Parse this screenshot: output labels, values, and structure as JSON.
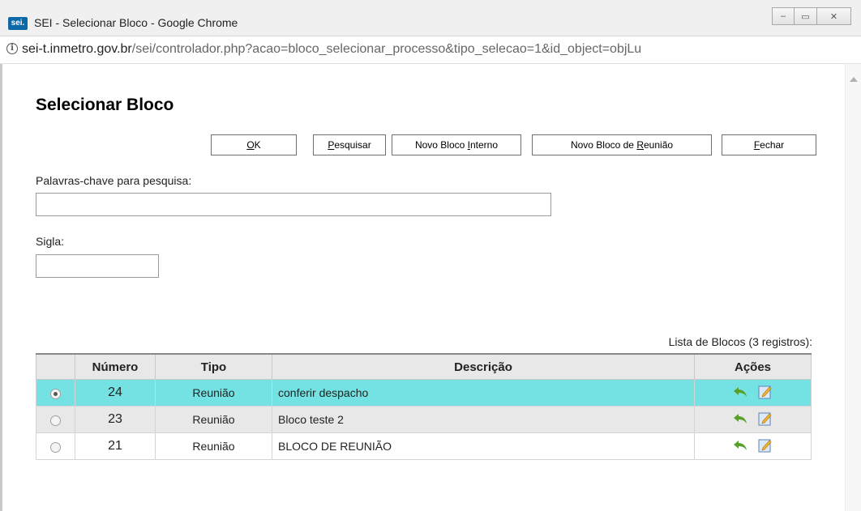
{
  "window": {
    "logo": "sei.",
    "title": "SEI - Selecionar Bloco - Google Chrome",
    "minimize_glyph": "–",
    "maximize_glyph": "▭",
    "close_glyph": "✕"
  },
  "address": {
    "host": "sei-t.inmetro.gov.br",
    "path": "/sei/controlador.php?acao=bloco_selecionar_processo&tipo_selecao=1&id_object=objLu"
  },
  "page": {
    "title": "Selecionar Bloco"
  },
  "toolbar": {
    "ok": {
      "pre": "",
      "key": "O",
      "post": "K"
    },
    "pesquisar": {
      "pre": "",
      "key": "P",
      "post": "esquisar"
    },
    "novo_interno": {
      "pre": "Novo Bloco ",
      "key": "I",
      "post": "nterno"
    },
    "novo_reuniao": {
      "pre": "Novo Bloco de ",
      "key": "R",
      "post": "eunião"
    },
    "fechar": {
      "pre": "",
      "key": "F",
      "post": "echar"
    }
  },
  "form": {
    "keywords_label": "Palavras-chave para pesquisa:",
    "keywords_value": "",
    "sigla_label": "Sigla:",
    "sigla_value": ""
  },
  "table": {
    "caption": "Lista de Blocos (3 registros):",
    "headers": {
      "radio": "",
      "numero": "Número",
      "tipo": "Tipo",
      "descricao": "Descrição",
      "acoes": "Ações"
    },
    "rows": [
      {
        "numero": "24",
        "tipo": "Reunião",
        "descricao": "conferir despacho"
      },
      {
        "numero": "23",
        "tipo": "Reunião",
        "descricao": "Bloco teste 2"
      },
      {
        "numero": "21",
        "tipo": "Reunião",
        "descricao": "BLOCO DE REUNIÃO"
      }
    ],
    "selected_row": 0,
    "action_icons": [
      "select-arrow-icon",
      "edit-pencil-icon"
    ]
  },
  "colors": {
    "selected_row": "#74e2e2",
    "alt_row": "#e8e8e8",
    "number_text": "#1a8f1a",
    "arrow_icon": "#5aa02c"
  }
}
